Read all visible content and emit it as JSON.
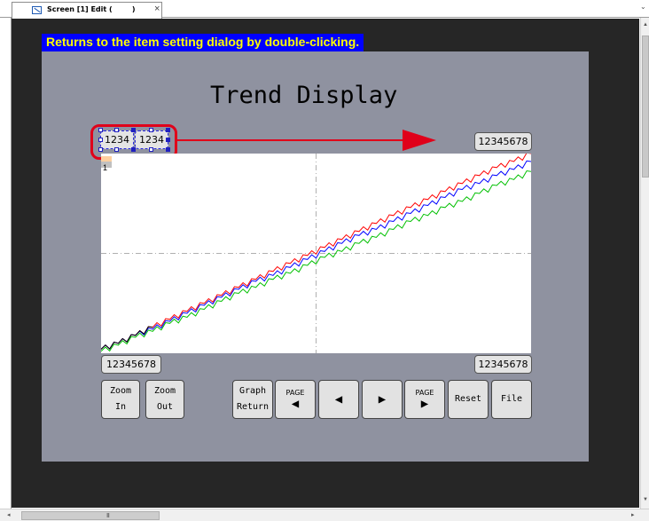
{
  "tab": {
    "label": "Screen [1] Edit (        )"
  },
  "tooltip": {
    "text": "Returns to the item setting dialog by double-clicking."
  },
  "screen": {
    "title": "Trend Display",
    "num_display_1": "1234",
    "num_display_2": "1234",
    "y_top_display": "12345678",
    "x_left_display": "12345678",
    "x_right_display": "12345678",
    "cursor_marker": "1",
    "colors": {
      "background": "#8f92a0",
      "callout": "#e0001a",
      "tooltip_bg": "#0000ff",
      "tooltip_fg": "#ffff00"
    }
  },
  "buttons": {
    "zoom_in": {
      "line1": "Zoom",
      "line2": "In"
    },
    "zoom_out": {
      "line1": "Zoom",
      "line2": "Out"
    },
    "graph_return": {
      "line1": "Graph",
      "line2": "Return"
    },
    "page_left": {
      "label": "PAGE",
      "icon": "left-triangle-icon"
    },
    "step_left": {
      "icon": "left-triangle-icon"
    },
    "step_right": {
      "icon": "right-triangle-icon"
    },
    "page_right": {
      "label": "PAGE",
      "icon": "right-triangle-icon"
    },
    "reset": {
      "label": "Reset"
    },
    "file": {
      "label": "File"
    }
  },
  "chart_data": {
    "type": "line",
    "x": [
      0,
      4,
      8,
      12,
      16,
      20,
      24,
      28,
      32,
      36,
      40,
      44,
      48,
      52,
      56,
      60,
      64,
      68,
      72,
      76,
      80,
      84,
      88,
      92,
      96,
      100
    ],
    "series": [
      {
        "color": "#ff0000",
        "values": [
          2,
          5,
          9,
          13,
          17,
          21,
          25,
          29,
          33,
          37,
          41,
          45,
          49,
          53,
          57,
          61,
          65,
          69,
          73,
          77,
          81,
          85,
          89,
          93,
          96,
          100
        ]
      },
      {
        "color": "#0000ff",
        "values": [
          2,
          5,
          9,
          12,
          16,
          20,
          24,
          28,
          32,
          36,
          39,
          43,
          47,
          51,
          55,
          59,
          62,
          66,
          70,
          74,
          78,
          82,
          85,
          89,
          92,
          96
        ]
      },
      {
        "color": "#00c000",
        "values": [
          1,
          4,
          8,
          11,
          15,
          18,
          22,
          26,
          30,
          33,
          37,
          40,
          44,
          48,
          51,
          55,
          58,
          62,
          66,
          69,
          73,
          76,
          80,
          84,
          87,
          91
        ]
      },
      {
        "color": "#000000",
        "values": [
          2,
          5,
          9,
          13
        ]
      }
    ],
    "xlim": [
      0,
      100
    ],
    "ylim": [
      0,
      100
    ],
    "grid": "center crosshair"
  }
}
